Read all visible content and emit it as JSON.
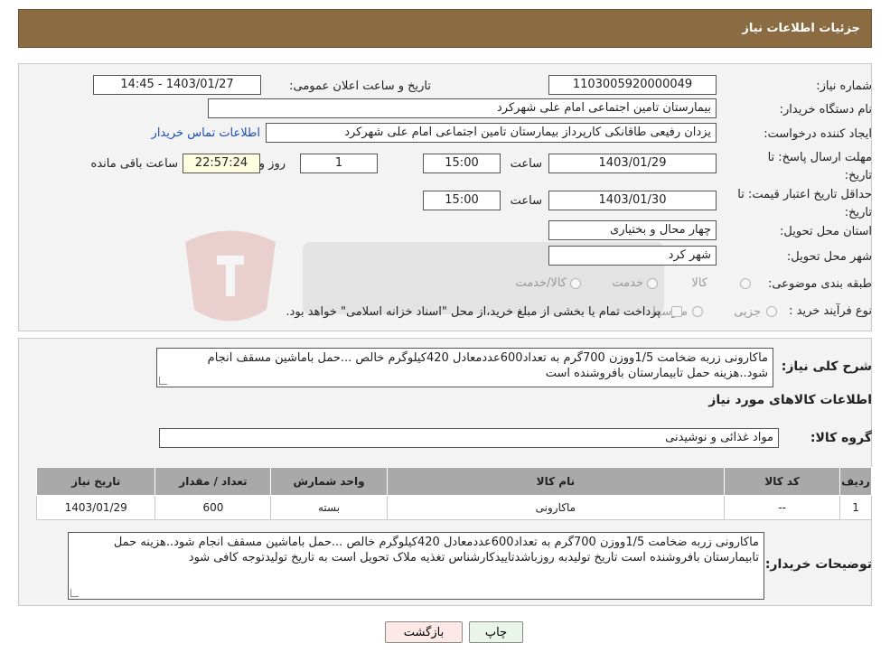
{
  "header": {
    "title": "جزئیات اطلاعات نیاز"
  },
  "form": {
    "need_number_label": "شماره نیاز:",
    "need_number": "1103005920000049",
    "announce_label": "تاریخ و ساعت اعلان عمومی:",
    "announce_value": "1403/01/27 - 14:45",
    "buyer_org_label": "نام دستگاه خریدار:",
    "buyer_org": "بیمارستان تامین اجتماعی امام علی شهرکرد",
    "creator_label": "ایجاد کننده درخواست:",
    "creator": "یزدان رفیعی طاقانکی کارپرداز بیمارستان تامین اجتماعی امام علی شهرکرد",
    "contact_link": "اطلاعات تماس خریدار",
    "reply_deadline_label": "مهلت ارسال پاسخ: تا تاریخ:",
    "reply_date": "1403/01/29",
    "time_label": "ساعت",
    "reply_time": "15:00",
    "days_value": "1",
    "days_label": "روز و",
    "remaining_time": "22:57:24",
    "remaining_label": "ساعت باقی مانده",
    "price_validity_label": "حداقل تاریخ اعتبار قیمت: تا تاریخ:",
    "price_date": "1403/01/30",
    "price_time": "15:00",
    "province_label": "استان محل تحویل:",
    "province": "چهار محال و بختیاری",
    "city_label": "شهر محل تحویل:",
    "city": "شهر کرد",
    "category_label": "طبقه بندی موضوعی:",
    "category_options": [
      "کالا",
      "خدمت",
      "کالا/خدمت"
    ],
    "process_label": "نوع فرآیند خرید :",
    "process_options": [
      "جزیی",
      "متوسط"
    ],
    "payment_note": "پرداخت تمام یا بخشی از مبلغ خرید،از محل \"اسناد خزانه اسلامی\" خواهد بود."
  },
  "summary": {
    "label": "شرح کلی نیاز:",
    "text": "ماکارونی زربه ضخامت 1/5ووزن 700گرم به تعداد600عددمعادل 420کیلوگرم خالص ...حمل باماشین مسقف انجام شود..هزینه حمل تابیمارستان بافروشنده است"
  },
  "goods": {
    "section_title": "اطلاعات کالاهای مورد نیاز",
    "group_label": "گروه کالا:",
    "group_value": "مواد غذائی و نوشیدنی",
    "table": {
      "headers": [
        "ردیف",
        "کد کالا",
        "نام کالا",
        "واحد شمارش",
        "تعداد / مقدار",
        "تاریخ نیاز"
      ],
      "rows": [
        [
          "1",
          "--",
          "ماکارونی",
          "بسته",
          "600",
          "1403/01/29"
        ]
      ]
    }
  },
  "buyer_notes": {
    "label": "توضیحات خریدار:",
    "text": "ماکارونی زربه ضخامت 1/5ووزن 700گرم به تعداد600عددمعادل 420کیلوگرم خالص ...حمل باماشین مسقف انجام شود..هزینه حمل تابیمارستان بافروشنده است تاریخ تولیدبه روزباشدتاییدکارشناس تغذیه ملاک تحویل است به تاریخ تولیدتوجه کافی شود"
  },
  "buttons": {
    "print": "چاپ",
    "back": "بازگشت"
  },
  "colors": {
    "header_bg": "#8b6c42",
    "table_header_bg": "#a9a9a9",
    "link": "#1a4fb8",
    "back_btn_bg": "#fde8e8"
  }
}
